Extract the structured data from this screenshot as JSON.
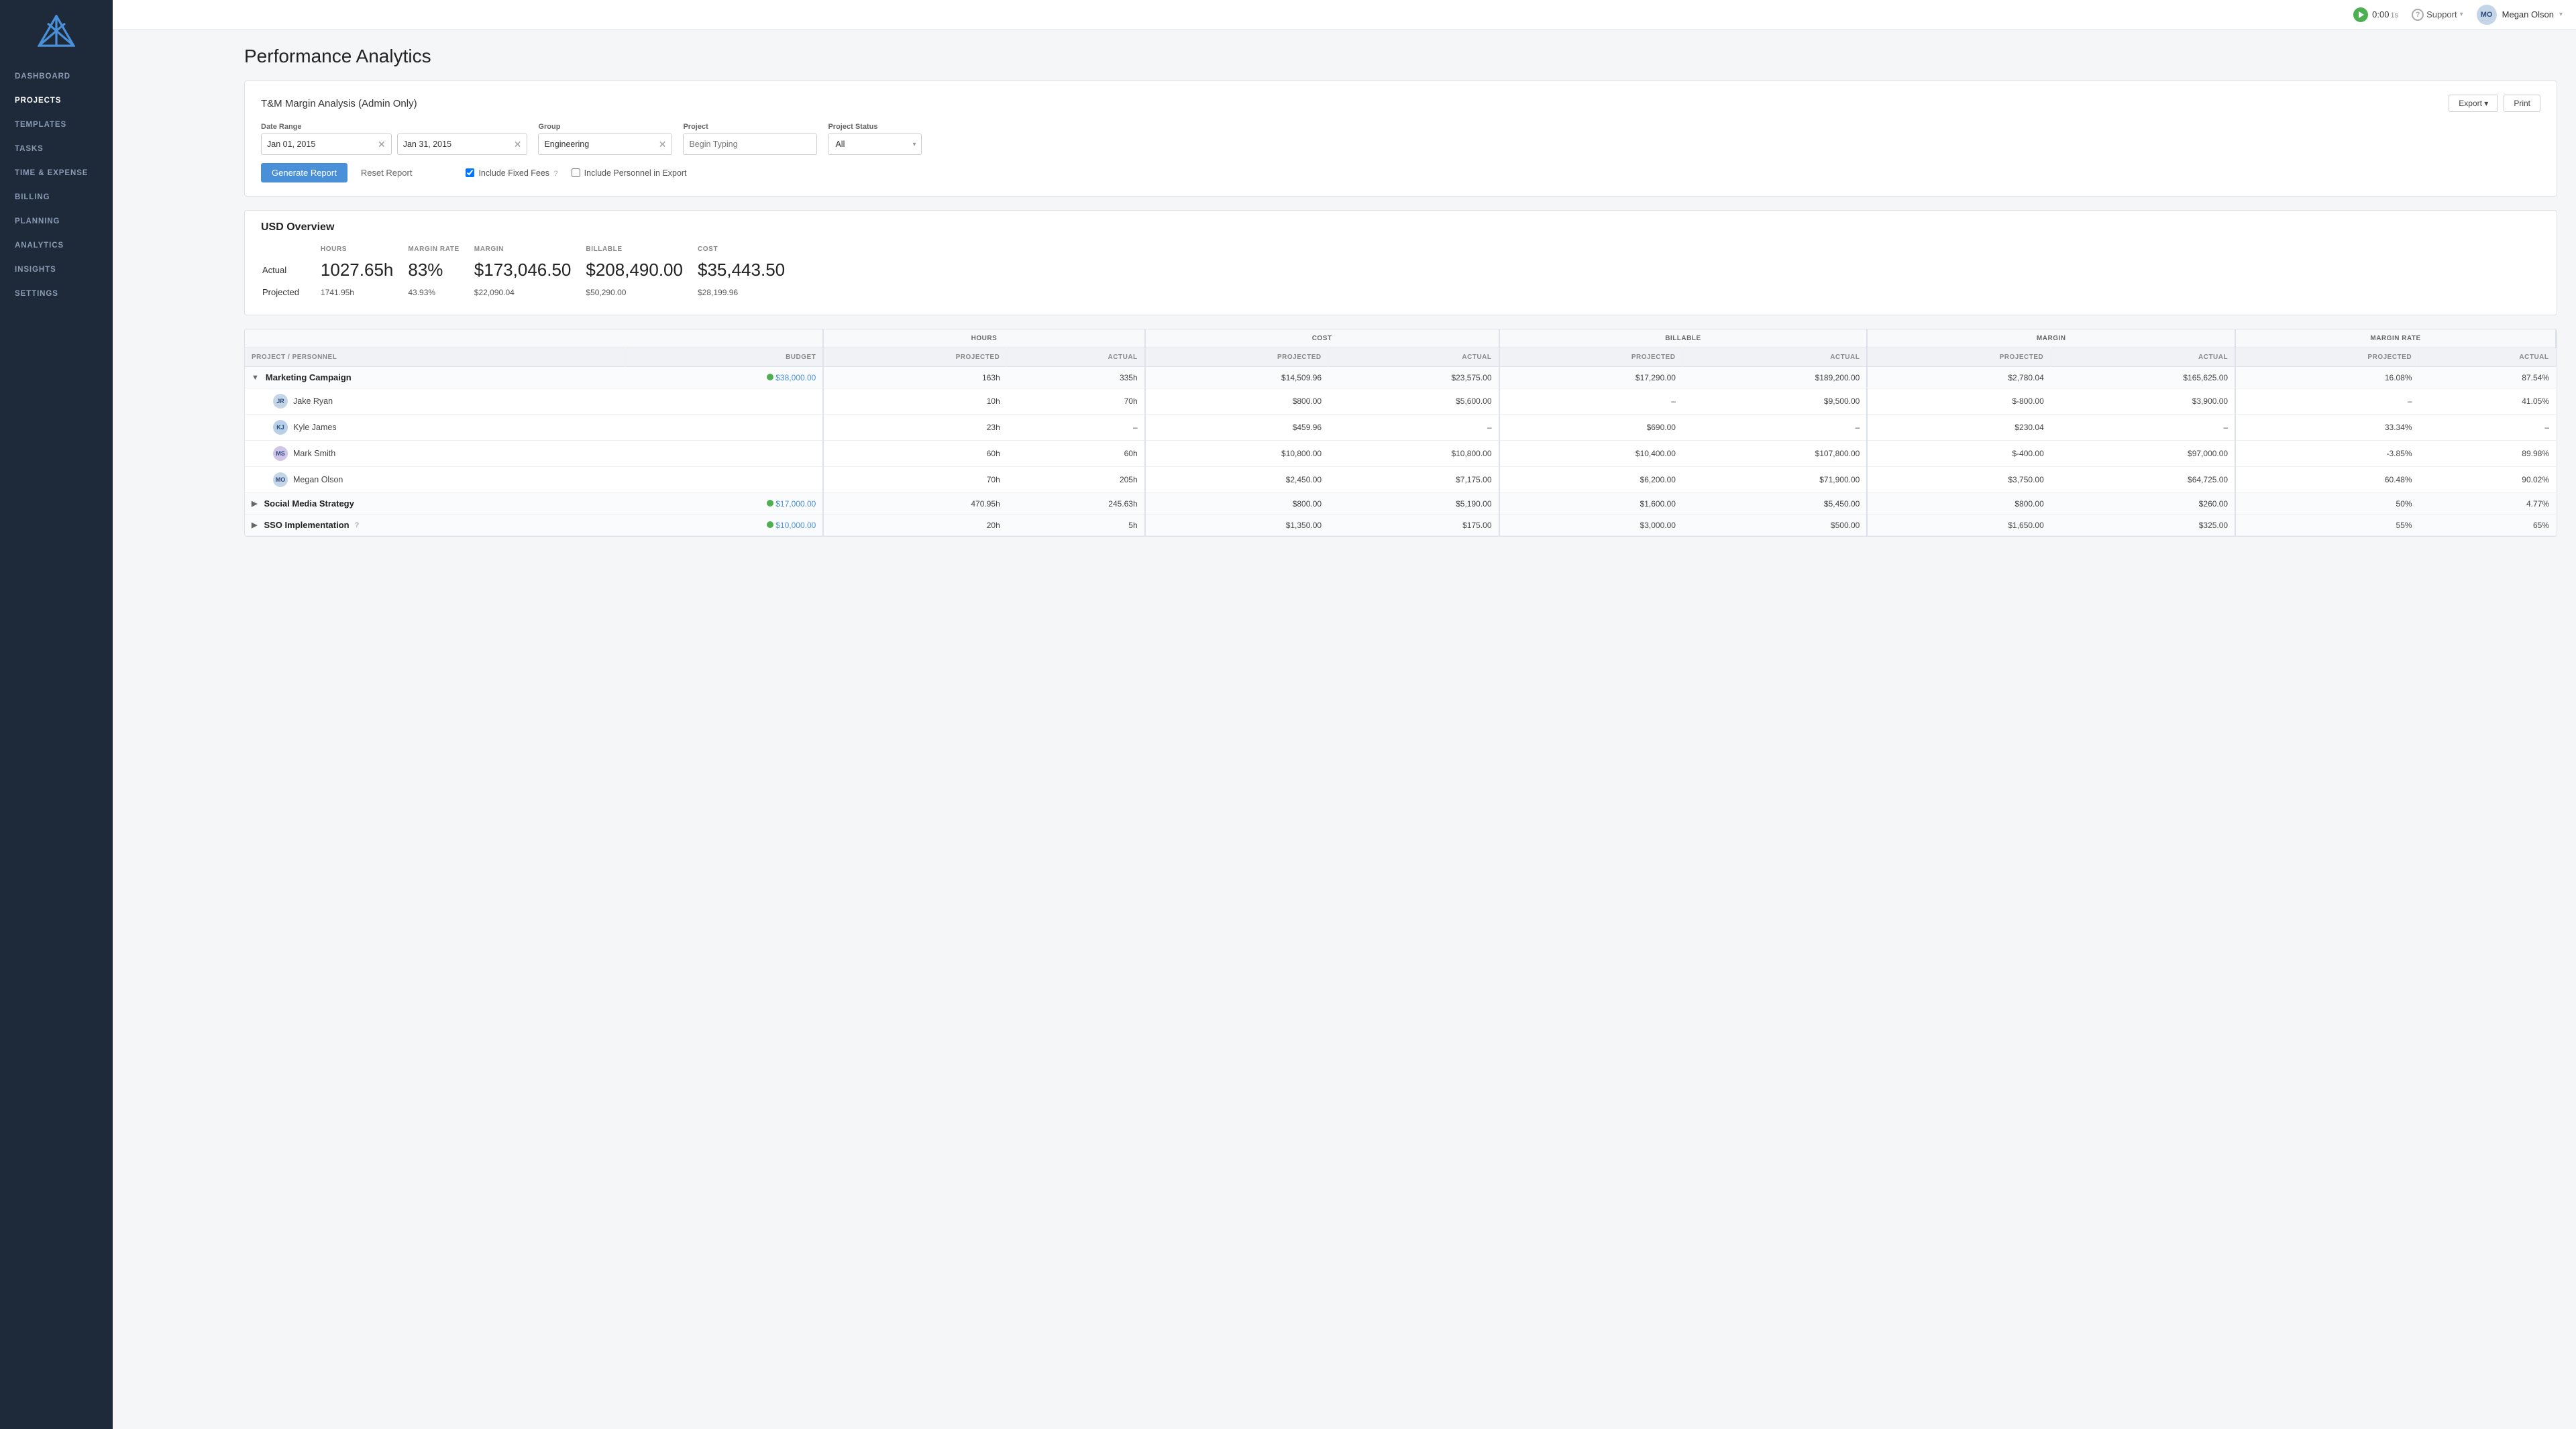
{
  "sidebar": {
    "logo_alt": "Mavenlink Logo",
    "nav_items": [
      {
        "id": "dashboard",
        "label": "DASHBOARD",
        "active": false
      },
      {
        "id": "projects",
        "label": "PROJECTS",
        "active": true
      },
      {
        "id": "templates",
        "label": "TEMPLATES",
        "active": false
      },
      {
        "id": "tasks",
        "label": "TASKS",
        "active": false
      },
      {
        "id": "time-expense",
        "label": "TIME & EXPENSE",
        "active": false
      },
      {
        "id": "billing",
        "label": "BILLING",
        "active": false
      },
      {
        "id": "planning",
        "label": "PLANNING",
        "active": false
      },
      {
        "id": "analytics",
        "label": "ANALYTICS",
        "active": false
      },
      {
        "id": "insights",
        "label": "INSIGHTS",
        "active": false
      },
      {
        "id": "settings",
        "label": "SETTINGS",
        "active": false
      }
    ]
  },
  "topbar": {
    "timer_value": "0:00",
    "timer_unit": "1s",
    "support_label": "Support",
    "user_name": "Megan Olson",
    "user_initials": "MO"
  },
  "page": {
    "title": "Performance Analytics"
  },
  "report": {
    "subtitle": "T&M Margin Analysis (Admin Only)",
    "export_label": "Export",
    "print_label": "Print",
    "date_range_label": "Date Range",
    "date_from": "Jan 01, 2015",
    "date_to": "Jan 31, 2015",
    "group_label": "Group",
    "group_value": "Engineering",
    "project_label": "Project",
    "project_placeholder": "Begin Typing",
    "status_label": "Project Status",
    "status_value": "All",
    "generate_label": "Generate Report",
    "reset_label": "Reset Report",
    "include_fixed_fees_label": "Include Fixed Fees",
    "include_fixed_fees_checked": true,
    "include_personnel_label": "Include Personnel in Export",
    "include_personnel_checked": false,
    "fixed_fees_help": "?"
  },
  "overview": {
    "title": "USD Overview",
    "columns": [
      "HOURS",
      "MARGIN RATE",
      "MARGIN",
      "BILLABLE",
      "COST"
    ],
    "rows": [
      {
        "label": "Actual",
        "values": [
          "1027.65h",
          "83%",
          "$173,046.50",
          "$208,490.00",
          "$35,443.50"
        ],
        "big": true
      },
      {
        "label": "Projected",
        "values": [
          "1741.95h",
          "43.93%",
          "$22,090.04",
          "$50,290.00",
          "$28,199.96"
        ],
        "big": false
      }
    ]
  },
  "table": {
    "col_groups": [
      {
        "label": "",
        "span": 2
      },
      {
        "label": "HOURS",
        "span": 2
      },
      {
        "label": "COST",
        "span": 2
      },
      {
        "label": "BILLABLE",
        "span": 2
      },
      {
        "label": "MARGIN",
        "span": 2
      },
      {
        "label": "MARGIN RATE",
        "span": 2
      }
    ],
    "sub_headers": [
      "PROJECT / PERSONNEL",
      "BUDGET",
      "PROJECTED",
      "ACTUAL",
      "PROJECTED",
      "ACTUAL",
      "PROJECTED",
      "ACTUAL",
      "PROJECTED",
      "ACTUAL",
      "PROJECTED",
      "ACTUAL"
    ],
    "rows": [
      {
        "type": "project",
        "expanded": true,
        "name": "Marketing Campaign",
        "status": "green",
        "budget": "$38,000.00",
        "hours_projected": "163h",
        "hours_actual": "335h",
        "cost_projected": "$14,509.96",
        "cost_actual": "$23,575.00",
        "billable_projected": "$17,290.00",
        "billable_actual": "$189,200.00",
        "margin_projected": "$2,780.04",
        "margin_actual": "$165,625.00",
        "margin_rate_projected": "16.08%",
        "margin_rate_actual": "87.54%"
      },
      {
        "type": "person",
        "name": "Jake Ryan",
        "initials": "JR",
        "avatar_color": "#c5d5e8",
        "hours_projected": "10h",
        "hours_actual": "70h",
        "cost_projected": "$800.00",
        "cost_actual": "$5,600.00",
        "billable_projected": "–",
        "billable_actual": "$9,500.00",
        "margin_projected": "$-800.00",
        "margin_actual": "$3,900.00",
        "margin_rate_projected": "–",
        "margin_rate_actual": "41.05%",
        "margin_projected_red": true
      },
      {
        "type": "person",
        "name": "Kyle James",
        "initials": "KJ",
        "avatar_color": "#b8cfe8",
        "hours_projected": "23h",
        "hours_actual": "–",
        "cost_projected": "$459.96",
        "cost_actual": "–",
        "billable_projected": "$690.00",
        "billable_actual": "–",
        "margin_projected": "$230.04",
        "margin_actual": "–",
        "margin_rate_projected": "33.34%",
        "margin_rate_actual": "–",
        "margin_projected_red": false
      },
      {
        "type": "person",
        "name": "Mark Smith",
        "initials": "MS",
        "avatar_color": "#d0c5e8",
        "hours_projected": "60h",
        "hours_actual": "60h",
        "cost_projected": "$10,800.00",
        "cost_actual": "$10,800.00",
        "billable_projected": "$10,400.00",
        "billable_actual": "$107,800.00",
        "margin_projected": "$-400.00",
        "margin_actual": "$97,000.00",
        "margin_rate_projected": "-3.85%",
        "margin_rate_actual": "89.98%",
        "margin_projected_red": true,
        "margin_rate_projected_red": true
      },
      {
        "type": "person",
        "name": "Megan Olson",
        "initials": "MO",
        "avatar_color": "#c5d5e8",
        "hours_projected": "70h",
        "hours_actual": "205h",
        "cost_projected": "$2,450.00",
        "cost_actual": "$7,175.00",
        "billable_projected": "$6,200.00",
        "billable_actual": "$71,900.00",
        "margin_projected": "$3,750.00",
        "margin_actual": "$64,725.00",
        "margin_rate_projected": "60.48%",
        "margin_rate_actual": "90.02%",
        "margin_projected_red": false
      },
      {
        "type": "project",
        "expanded": false,
        "name": "Social Media Strategy",
        "status": "green",
        "budget": "$17,000.00",
        "hours_projected": "470.95h",
        "hours_actual": "245.63h",
        "cost_projected": "$800.00",
        "cost_actual": "$5,190.00",
        "billable_projected": "$1,600.00",
        "billable_actual": "$5,450.00",
        "margin_projected": "$800.00",
        "margin_actual": "$260.00",
        "margin_rate_projected": "50%",
        "margin_rate_actual": "4.77%"
      },
      {
        "type": "project",
        "expanded": false,
        "name": "SSO Implementation",
        "has_help": true,
        "status": "green",
        "budget": "$10,000.00",
        "hours_projected": "20h",
        "hours_actual": "5h",
        "cost_projected": "$1,350.00",
        "cost_actual": "$175.00",
        "billable_projected": "$3,000.00",
        "billable_actual": "$500.00",
        "margin_projected": "$1,650.00",
        "margin_actual": "$325.00",
        "margin_rate_projected": "55%",
        "margin_rate_actual": "65%"
      }
    ]
  }
}
